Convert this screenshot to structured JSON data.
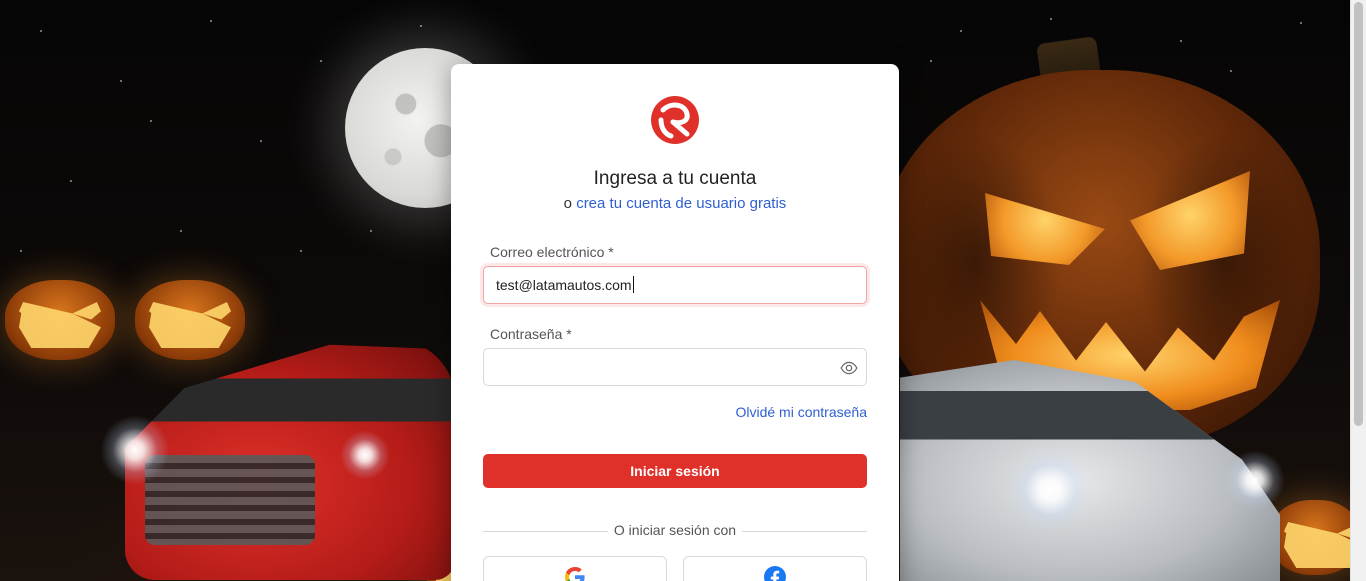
{
  "login": {
    "title": "Ingresa a tu cuenta",
    "subtitle_prefix": "o",
    "signup_link": "crea tu cuenta de usuario gratis",
    "email": {
      "label": "Correo electrónico *",
      "value": "test@latamautos.com"
    },
    "password": {
      "label": "Contraseña *",
      "value": ""
    },
    "forgot_link": "Olvidé mi contraseña",
    "submit_label": "Iniciar sesión",
    "divider_text": "O iniciar sesión con",
    "social": [
      "google-icon",
      "facebook-icon"
    ]
  },
  "colors": {
    "brand_red": "#e0302a",
    "link_blue": "#2f5fd0"
  },
  "icons": {
    "logo": "brand-logo",
    "password_toggle": "eye-icon"
  }
}
